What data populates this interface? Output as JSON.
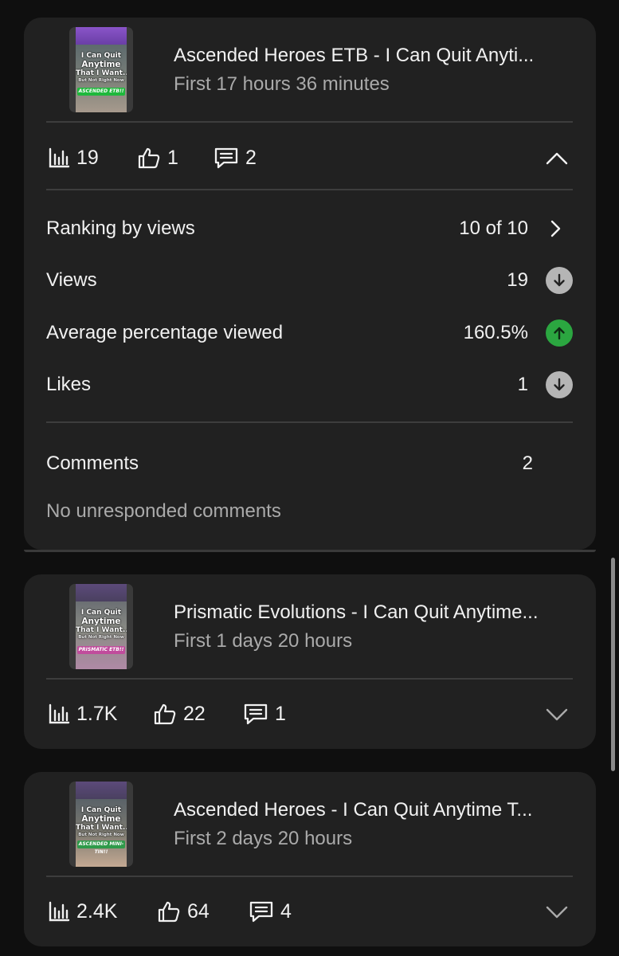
{
  "videos": [
    {
      "title": "Ascended Heroes ETB - I Can Quit Anyti...",
      "subtitle": "First 17 hours 36 minutes",
      "thumbnail": {
        "line1": "I Can Quit",
        "line2": "Anytime",
        "line3": "That I Want...",
        "line4": "But Not Right Now",
        "tag": "ASCENDED ETB!!"
      },
      "views": "19",
      "likes": "1",
      "comments": "2",
      "expanded": true,
      "details": {
        "ranking_label": "Ranking by views",
        "ranking_value": "10 of 10",
        "views_label": "Views",
        "views_value": "19",
        "avg_label": "Average percentage viewed",
        "avg_value": "160.5%",
        "likes_label": "Likes",
        "likes_value": "1",
        "comments_label": "Comments",
        "comments_value": "2",
        "no_unresponded": "No unresponded comments"
      }
    },
    {
      "title": "Prismatic Evolutions - I Can Quit Anytime...",
      "subtitle": "First 1 days 20 hours",
      "thumbnail": {
        "line1": "I Can Quit",
        "line2": "Anytime",
        "line3": "That I Want...",
        "line4": "But Not Right Now",
        "tag": "PRISMATIC ETB!!"
      },
      "views": "1.7K",
      "likes": "22",
      "comments": "1",
      "expanded": false
    },
    {
      "title": "Ascended Heroes - I Can Quit Anytime T...",
      "subtitle": "First 2 days 20 hours",
      "thumbnail": {
        "line1": "I Can Quit",
        "line2": "Anytime",
        "line3": "That I Want...",
        "line4": "But Not Right Now",
        "tag": "ASCENDED MINI-TIN!!"
      },
      "views": "2.4K",
      "likes": "64",
      "comments": "4",
      "expanded": false
    }
  ],
  "icons": {
    "views": "bar-chart-icon",
    "likes": "thumbs-up-icon",
    "comments": "comment-icon",
    "collapse": "chevron-up-icon",
    "expand": "chevron-down-icon",
    "ranking": "chevron-right-icon",
    "trend_down": "arrow-down-circle-icon",
    "trend_up": "arrow-up-circle-icon"
  },
  "colors": {
    "background": "#0f0f0f",
    "card": "#212121",
    "text_primary": "#f1f1f1",
    "text_secondary": "#aaaaaa",
    "trend_up": "#2ba640",
    "trend_neutral": "#b5b5b5"
  }
}
